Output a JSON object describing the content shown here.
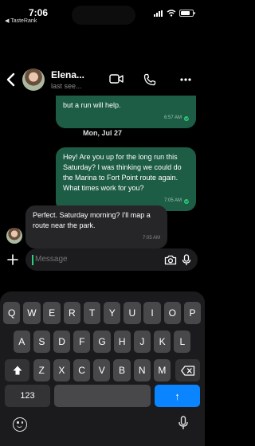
{
  "status_bar": {
    "time": "7:06",
    "back_app": "◀ TasteRank"
  },
  "header": {
    "contact_name": "Elena...",
    "contact_status": "last see..."
  },
  "messages": {
    "partial_out": {
      "text": "but a run will help.",
      "time": "6:57 AM"
    },
    "date_separator": "Mon, Jul 27",
    "out_1": {
      "text": "Hey! Are you up for the long run this Saturday? I was thinking we could do the Marina to Fort Point route again. What times work for you?",
      "time": "7:05 AM"
    },
    "in_1": {
      "text": "Perfect. Saturday morning? I'll map a route near the park.",
      "time": "7:05 AM"
    }
  },
  "composer": {
    "placeholder": "Message"
  },
  "keyboard": {
    "row1": [
      "Q",
      "W",
      "E",
      "R",
      "T",
      "Y",
      "U",
      "I",
      "O",
      "P"
    ],
    "row2": [
      "A",
      "S",
      "D",
      "F",
      "G",
      "H",
      "J",
      "K",
      "L"
    ],
    "row3": [
      "Z",
      "X",
      "C",
      "V",
      "B",
      "N",
      "M"
    ],
    "numbers_label": "123",
    "return_label": "↑"
  },
  "colors": {
    "outgoing_bubble": "#1d5c45",
    "incoming_bubble": "#262628",
    "accent": "#0a84ff",
    "read_check": "#2ecf7a"
  }
}
